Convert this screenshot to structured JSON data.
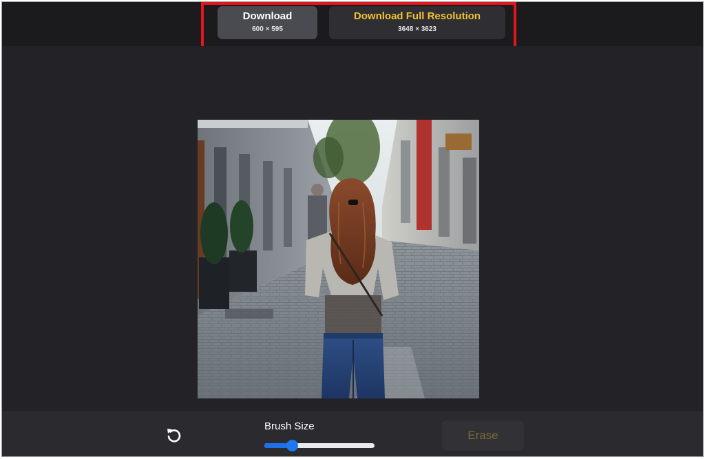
{
  "download": {
    "basic": {
      "label": "Download",
      "size": "600 × 595"
    },
    "full": {
      "label": "Download Full Resolution",
      "size": "3648 × 3623"
    }
  },
  "toolbar": {
    "undo_icon": "undo-icon",
    "brush_size_label": "Brush Size",
    "brush_size_value": 0.25,
    "erase_label": "Erase"
  },
  "colors": {
    "accent_yellow": "#f2c12e",
    "slider_blue": "#1f78f0",
    "highlight_red": "#e3161b"
  }
}
